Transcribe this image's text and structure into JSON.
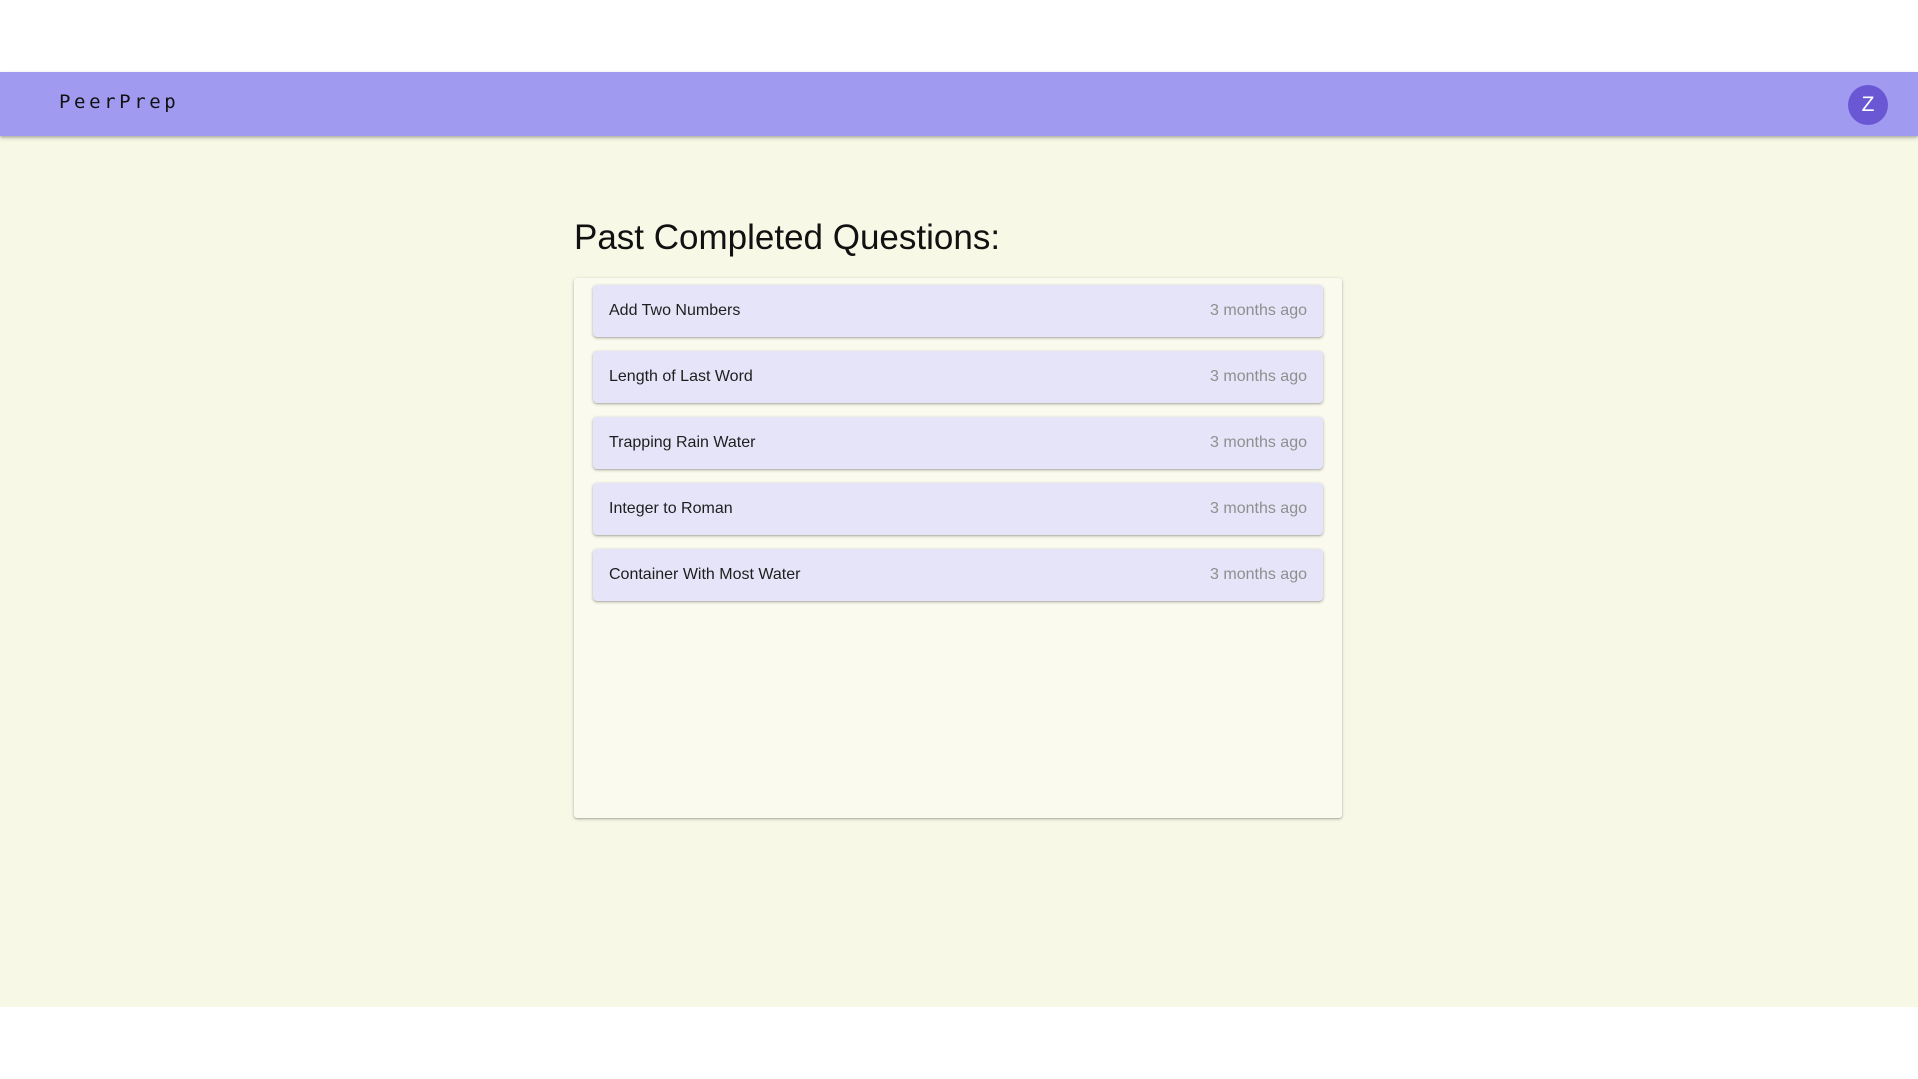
{
  "app": {
    "brand": "PeerPrep",
    "avatar_initial": "Z"
  },
  "page": {
    "title": "Past Completed Questions:"
  },
  "questions": [
    {
      "title": "Add Two Numbers",
      "completed": "3 months ago"
    },
    {
      "title": "Length of Last Word",
      "completed": "3 months ago"
    },
    {
      "title": "Trapping Rain Water",
      "completed": "3 months ago"
    },
    {
      "title": "Integer to Roman",
      "completed": "3 months ago"
    },
    {
      "title": "Container With Most Water",
      "completed": "3 months ago"
    }
  ],
  "colors": {
    "navbar": "#a09bf0",
    "avatar": "#6a57d4",
    "background": "#f7f8e6",
    "item": "#e6e4f8"
  }
}
